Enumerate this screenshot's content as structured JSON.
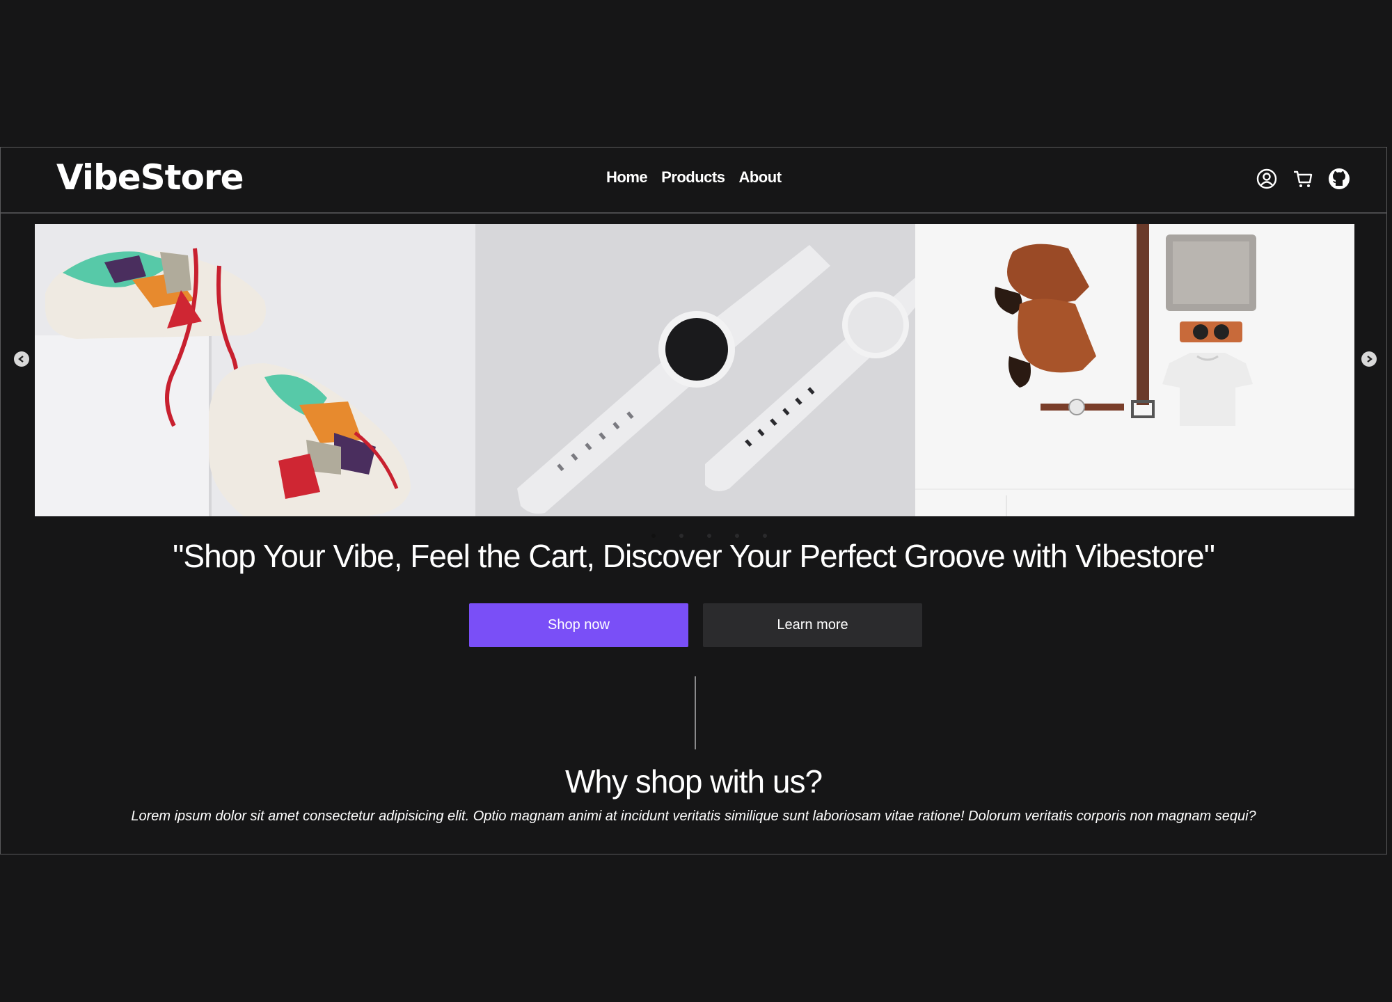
{
  "header": {
    "logo": "VibeStore",
    "nav": [
      {
        "label": "Home"
      },
      {
        "label": "Products"
      },
      {
        "label": "About"
      }
    ],
    "icons": [
      "user-icon",
      "cart-icon",
      "github-icon"
    ]
  },
  "carousel": {
    "slides": [
      {
        "name": "sneakers"
      },
      {
        "name": "smartwatches"
      },
      {
        "name": "men-fashion-flatlay"
      }
    ],
    "dot_count": 5,
    "active_dot": 0
  },
  "hero": {
    "tagline": "\"Shop Your Vibe, Feel the Cart, Discover Your Perfect Groove with Vibestore\"",
    "primary_button": "Shop now",
    "secondary_button": "Learn more"
  },
  "why": {
    "title": "Why shop with us?",
    "text": "Lorem ipsum dolor sit amet consectetur adipisicing elit. Optio magnam animi at incidunt veritatis similique sunt laboriosam vitae ratione! Dolorum veritatis corporis non magnam sequi?"
  },
  "colors": {
    "background": "#161617",
    "accent": "#7a4ff7",
    "secondary_button": "#2b2b2d"
  }
}
